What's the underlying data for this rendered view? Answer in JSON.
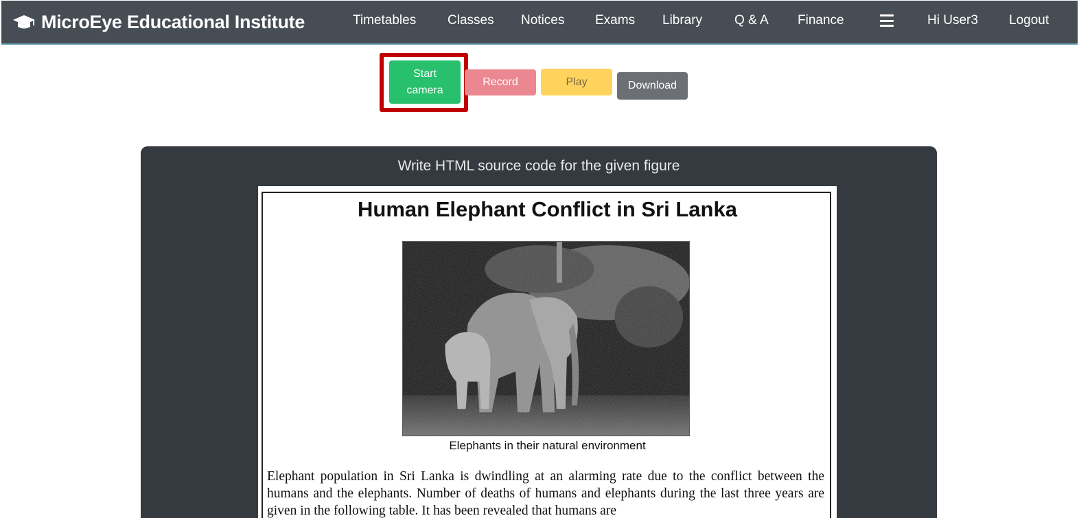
{
  "navbar": {
    "brand": "MicroEye Educational Institute",
    "links": [
      "Timetables",
      "Classes",
      "Notices",
      "Exams",
      "Library",
      "Q & A",
      "Finance"
    ],
    "user_greeting": "Hi User3",
    "logout": "Logout"
  },
  "controls": {
    "start_camera": "Start camera",
    "record": "Record",
    "play": "Play",
    "download": "Download"
  },
  "colors": {
    "start_camera": "#28c06d",
    "record": "#eb8790",
    "play": "#ffd35c",
    "download": "#6c7075",
    "highlight": "#c00000",
    "navbar": "#474d55",
    "panel": "#343a40"
  },
  "question": {
    "prompt": "Write HTML source code for the given figure"
  },
  "figure": {
    "title": "Human Elephant Conflict in Sri Lanka",
    "caption": "Elephants in their natural environment",
    "body": "Elephant population in Sri Lanka is dwindling at an alarming rate due to the conflict between the humans and the elephants. Number of deaths of humans and elephants during the last three years are given in the following table. It has been revealed that humans are"
  }
}
